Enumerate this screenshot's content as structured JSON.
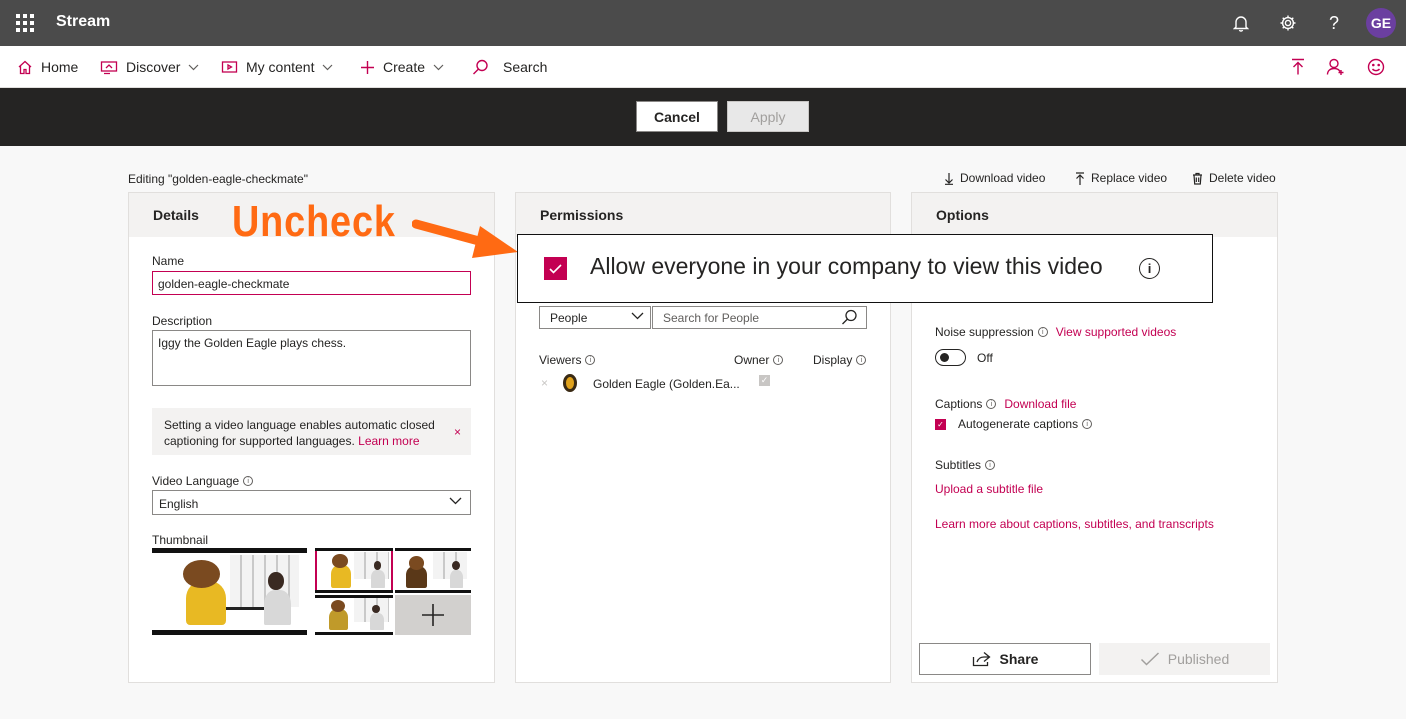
{
  "suite": {
    "app_title": "Stream",
    "avatar_initials": "GE",
    "help_glyph": "?",
    "icons": [
      "waffle-icon",
      "bell-icon",
      "gear-icon",
      "help-icon"
    ]
  },
  "nav": {
    "home": "Home",
    "discover": "Discover",
    "my_content": "My content",
    "create": "Create",
    "search": "Search",
    "right_icons": [
      "upload-icon",
      "add-person-icon",
      "smiley-icon"
    ]
  },
  "actions": {
    "cancel": "Cancel",
    "apply": "Apply"
  },
  "editing_label": "Editing \"golden-eagle-checkmate\"",
  "video_actions": {
    "download": "Download video",
    "replace": "Replace video",
    "delete": "Delete video"
  },
  "details": {
    "header": "Details",
    "name_label": "Name",
    "name_value": "golden-eagle-checkmate",
    "description_label": "Description",
    "description_value": "Iggy the Golden Eagle plays chess.",
    "language_note": "Setting a video language enables automatic closed captioning for supported languages.",
    "learn_more": "Learn more",
    "close_glyph": "×",
    "video_language_label": "Video Language",
    "video_language_value": "English",
    "thumbnail_label": "Thumbnail"
  },
  "permissions": {
    "header": "Permissions",
    "allow_everyone": "Allow everyone in your company to view this video",
    "allow_everyone_checked": true,
    "people_select": "People",
    "search_placeholder": "Search for People",
    "columns": {
      "viewers": "Viewers",
      "owner": "Owner",
      "display": "Display"
    },
    "viewers": [
      {
        "name": "Golden Eagle (Golden.Ea...",
        "owner": true,
        "remove_glyph": "×"
      }
    ]
  },
  "options": {
    "header": "Options",
    "noise_label": "Noise suppression",
    "noise_link": "View supported videos",
    "noise_state": "Off",
    "captions_label": "Captions",
    "captions_link": "Download file",
    "autogenerate": "Autogenerate captions",
    "autogenerate_checked": true,
    "subtitles_label": "Subtitles",
    "upload_subtitle": "Upload a subtitle file",
    "learn_more_captions": "Learn more about captions, subtitles, and transcripts",
    "share": "Share",
    "published": "Published"
  },
  "annotation": {
    "label": "Uncheck",
    "color": "#ff6a13"
  },
  "colors": {
    "accent": "#c30052",
    "suite_bar": "#4b4b4b",
    "action_bar": "#252423"
  }
}
